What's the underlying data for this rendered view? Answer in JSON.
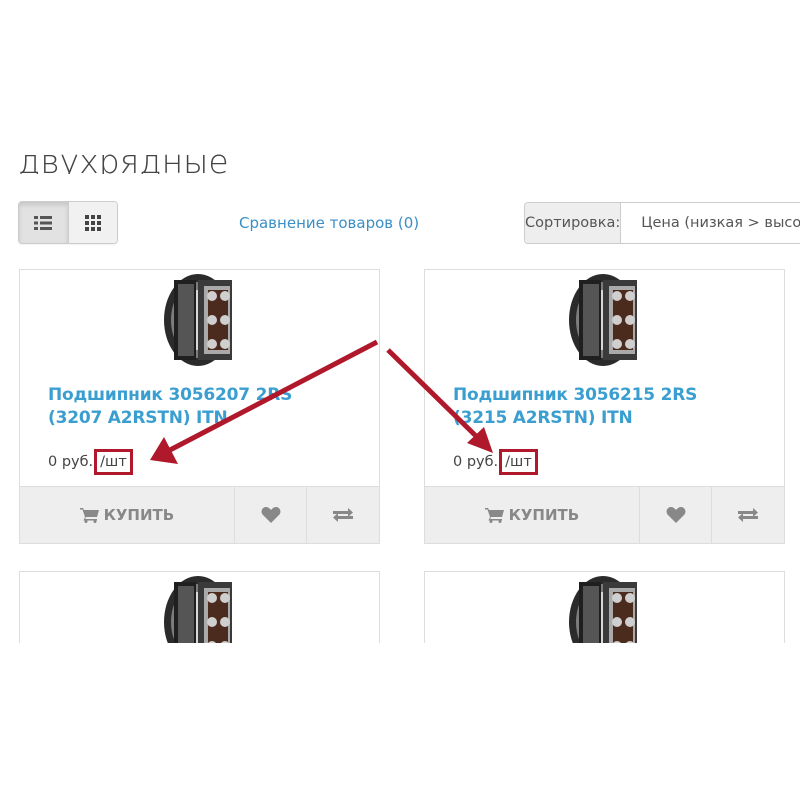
{
  "page": {
    "title": "двухрядные",
    "compare_link": "Сравнение товаров (0)",
    "sort": {
      "label": "Сортировка:",
      "selected": "Цена (низкая > высокая)"
    },
    "view_modes": [
      "list-view-icon",
      "grid-view-icon"
    ],
    "active_view": "grid"
  },
  "products": [
    {
      "name": "Подшипник 3056207 2RS (3207 A2RSTN) ITN",
      "price": "0 руб.",
      "unit": "/шт",
      "buy_label": "КУПИТЬ"
    },
    {
      "name": "Подшипник 3056215 2RS (3215 A2RSTN) ITN",
      "price": "0 руб.",
      "unit": "/шт",
      "buy_label": "КУПИТЬ"
    },
    {
      "name": "",
      "price": "",
      "unit": "",
      "buy_label": ""
    },
    {
      "name": "",
      "price": "",
      "unit": "",
      "buy_label": ""
    }
  ],
  "colors": {
    "link": "#3a8fc4",
    "product_name": "#3a9fd0",
    "highlight": "#b0192c",
    "button_bg": "#eeeeee"
  },
  "icons": {
    "buy": "cart-icon",
    "wishlist": "heart-icon",
    "compare": "exchange-icon"
  }
}
